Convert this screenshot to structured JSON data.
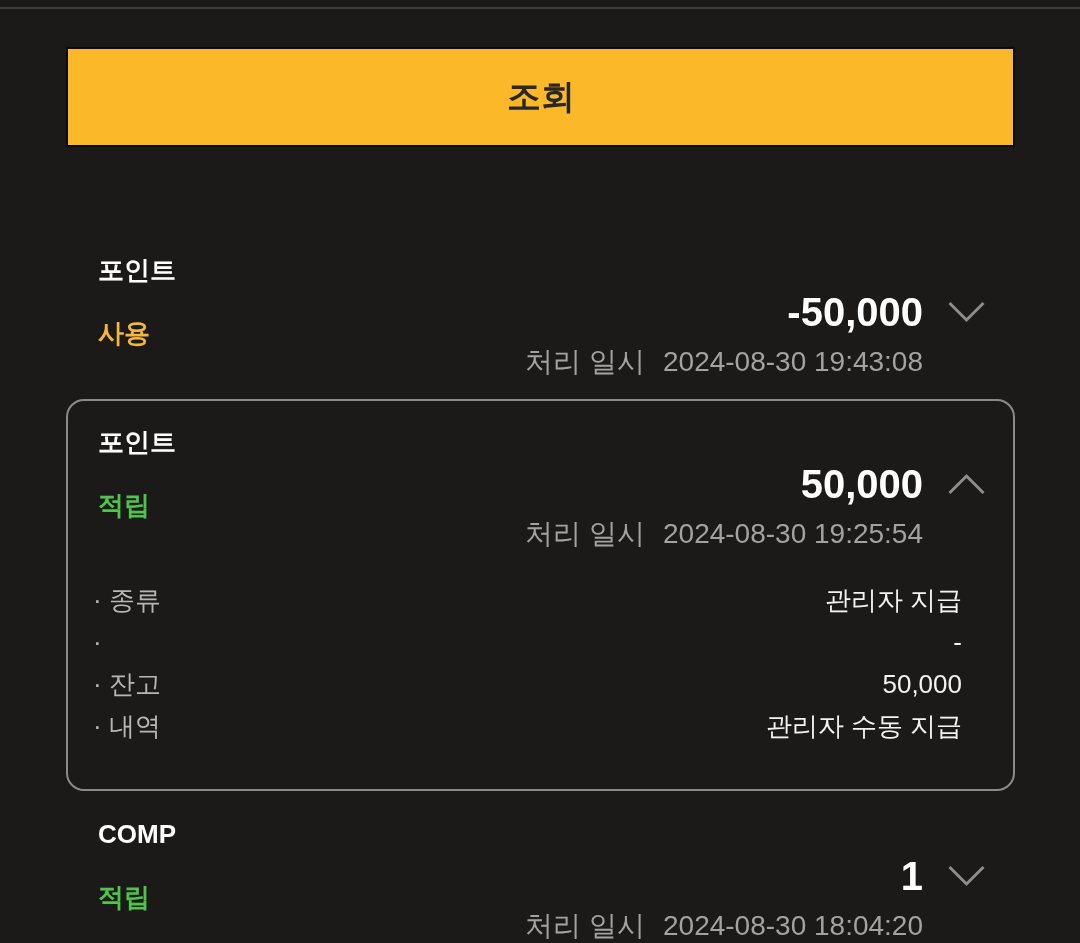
{
  "search_button": {
    "label": "조회"
  },
  "transactions": [
    {
      "category": "포인트",
      "type": "사용",
      "color": "#f5b73b",
      "amount": "-50,000",
      "date_label": "처리 일시",
      "date": "2024-08-30 19:43:08",
      "expanded": false
    },
    {
      "category": "포인트",
      "type": "적립",
      "color": "#4fc44b",
      "amount": "50,000",
      "date_label": "처리 일시",
      "date": "2024-08-30 19:25:54",
      "expanded": true,
      "details": [
        {
          "label": "· 종류",
          "value": "관리자 지급"
        },
        {
          "label": "·",
          "value": "-"
        },
        {
          "label": "· 잔고",
          "value": "50,000"
        },
        {
          "label": "· 내역",
          "value": "관리자 수동 지급"
        }
      ]
    },
    {
      "category": "COMP",
      "type": "적립",
      "color": "#4fc44b",
      "amount": "1",
      "date_label": "처리 일시",
      "date": "2024-08-30 18:04:20",
      "expanded": false
    }
  ]
}
